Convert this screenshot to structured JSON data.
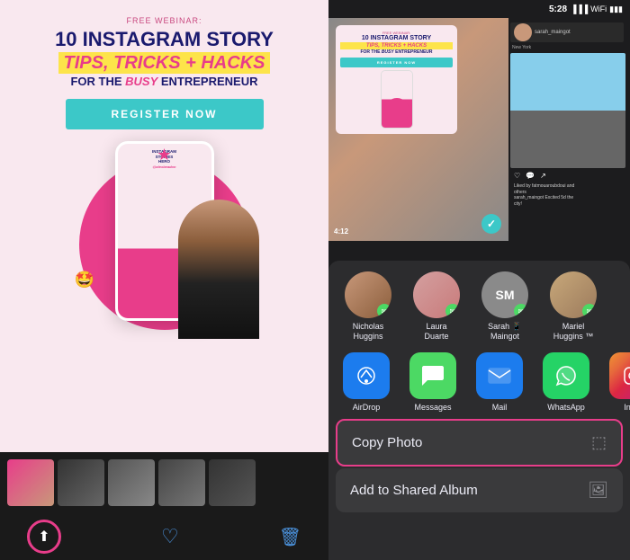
{
  "left": {
    "webinar_label": "FREE WEBINAR:",
    "title_line1": "10 INSTAGRAM STORY",
    "title_line2": "TIPS, TRICKS + HACKS",
    "title_line3_pre": "FOR THE ",
    "title_line3_italic": "busy",
    "title_line3_post": " ENTREPRENEUR",
    "register_btn": "REGISTER NOW",
    "thumbnails": [
      "thumb0",
      "thumb1",
      "thumb2",
      "thumb3",
      "thumb4"
    ]
  },
  "right": {
    "status_time": "5:28",
    "contacts": [
      {
        "name": "Nicholas\nHuggins",
        "type": "photo",
        "index": 1
      },
      {
        "name": "Laura\nDuarte",
        "type": "photo",
        "index": 2
      },
      {
        "name": "Sarah\nMaingot",
        "type": "initials",
        "initials": "SM",
        "index": 3
      },
      {
        "name": "Mariel\nHuggins",
        "type": "photo",
        "index": 4
      }
    ],
    "apps": [
      {
        "name": "AirDrop",
        "type": "airdrop"
      },
      {
        "name": "Messages",
        "type": "messages"
      },
      {
        "name": "Mail",
        "type": "mail"
      },
      {
        "name": "WhatsApp",
        "type": "whatsapp"
      },
      {
        "name": "Ins...",
        "type": "instagram"
      }
    ],
    "actions": [
      {
        "label": "Copy Photo",
        "icon": "📋",
        "highlighted": true
      },
      {
        "label": "Add to Shared Album",
        "icon": "🖼",
        "highlighted": false
      }
    ],
    "video_time": "4:12"
  }
}
